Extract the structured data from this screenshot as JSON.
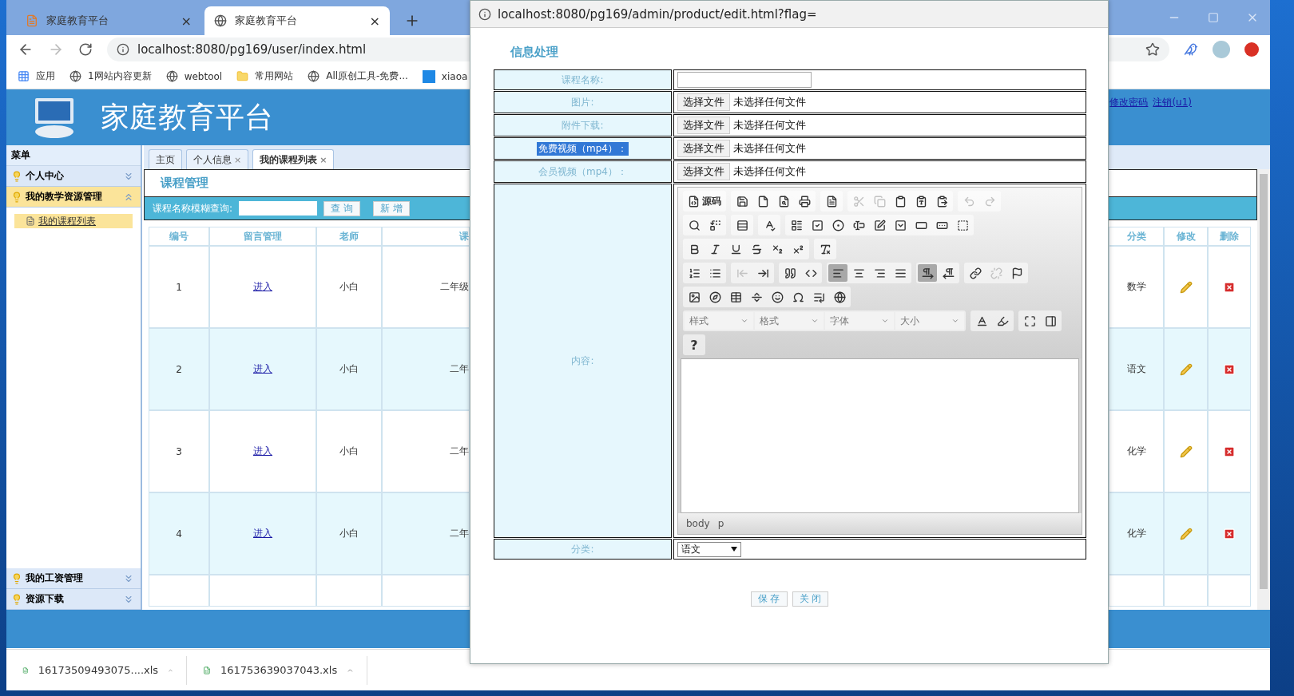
{
  "browser": {
    "tabs": [
      {
        "title": "家庭教育平台",
        "selected": false,
        "close": "×"
      },
      {
        "title": "家庭教育平台",
        "selected": true,
        "close": "×"
      }
    ],
    "url": "localhost:8080/pg169/user/index.html",
    "bookmarks": [
      {
        "label": "应用",
        "kind": "apps"
      },
      {
        "label": "1网站内容更新",
        "kind": "globe"
      },
      {
        "label": "webtool",
        "kind": "globe"
      },
      {
        "label": "常用网站",
        "kind": "folder"
      },
      {
        "label": "All原创工具-免费...",
        "kind": "globe"
      },
      {
        "label": "xiaoa",
        "kind": "p"
      }
    ]
  },
  "header": {
    "title": "家庭教育平台",
    "links": [
      "修改密码",
      "注销(u1)"
    ]
  },
  "sidebar": {
    "title": "菜单",
    "items": [
      {
        "label": "个人中心",
        "expanded": false
      },
      {
        "label": "我的教学资源管理",
        "expanded": true,
        "children": [
          {
            "label": "我的课程列表",
            "selected": true
          }
        ]
      },
      {
        "label": "我的工资管理",
        "expanded": false
      },
      {
        "label": "资源下载",
        "expanded": false
      }
    ]
  },
  "content_tabs": [
    {
      "label": "主页",
      "selected": false
    },
    {
      "label": "个人信息",
      "close": "×",
      "selected": false
    },
    {
      "label": "我的课程列表",
      "close": "×",
      "selected": true
    }
  ],
  "panel": {
    "title": "课程管理",
    "search_label": "课程名称模糊查询:",
    "buttons": [
      "查 询",
      "新 增"
    ]
  },
  "table": {
    "columns": [
      "编号",
      "留言管理",
      "老师",
      "课",
      "分类",
      "修改",
      "删除"
    ],
    "rows": [
      {
        "id": "1",
        "link": "进入",
        "teacher": "小白",
        "column_4": "二年级",
        "category": "数学"
      },
      {
        "id": "2",
        "link": "进入",
        "teacher": "小白",
        "column_4": "二年",
        "category": "语文"
      },
      {
        "id": "3",
        "link": "进入",
        "teacher": "小白",
        "column_4": "二年",
        "category": "化学"
      },
      {
        "id": "4",
        "link": "进入",
        "teacher": "小白",
        "column_4": "二年",
        "category": "化学"
      }
    ]
  },
  "dialog": {
    "url": "localhost:8080/pg169/admin/product/edit.html?flag=",
    "title": "信息处理",
    "fields": [
      {
        "label": "课程名称:",
        "kind": "text",
        "highlighted": false
      },
      {
        "label": "图片:",
        "kind": "file",
        "button": "选择文件",
        "status": "未选择任何文件",
        "highlighted": false
      },
      {
        "label": "附件下载:",
        "kind": "file",
        "button": "选择文件",
        "status": "未选择任何文件",
        "highlighted": false
      },
      {
        "label": "免费视频（mp4）：",
        "kind": "file",
        "button": "选择文件",
        "status": "未选择任何文件",
        "highlighted": true
      },
      {
        "label": "会员视频（mp4）：",
        "kind": "file",
        "button": "选择文件",
        "status": "未选择任何文件",
        "highlighted": false
      },
      {
        "label": "内容:",
        "kind": "editor",
        "highlighted": false
      },
      {
        "label": "分类:",
        "kind": "select",
        "value": "语文",
        "highlighted": false
      }
    ],
    "editor": {
      "toolbar": [
        [
          [
            {
              "kind": "icon_label",
              "label": "源码",
              "disabled": false
            }
          ],
          [
            {
              "kind": "icon",
              "disabled": false
            },
            {
              "kind": "icon",
              "disabled": false
            },
            {
              "kind": "icon",
              "disabled": false
            },
            {
              "kind": "icon",
              "disabled": false
            }
          ],
          [
            {
              "kind": "icon",
              "disabled": false
            }
          ],
          [
            {
              "kind": "icon",
              "disabled": true
            },
            {
              "kind": "icon",
              "disabled": true
            },
            {
              "kind": "icon",
              "disabled": false
            },
            {
              "kind": "icon",
              "disabled": false
            },
            {
              "kind": "icon",
              "disabled": false
            }
          ],
          [
            {
              "kind": "icon",
              "disabled": true
            },
            {
              "kind": "icon",
              "disabled": true
            }
          ]
        ],
        [
          [
            {
              "kind": "icon",
              "disabled": false
            },
            {
              "kind": "icon",
              "disabled": false
            }
          ],
          [
            {
              "kind": "icon",
              "disabled": false
            }
          ],
          [
            {
              "kind": "icon",
              "disabled": false
            }
          ],
          [
            {
              "kind": "icon",
              "disabled": false
            },
            {
              "kind": "icon",
              "disabled": false
            },
            {
              "kind": "icon",
              "disabled": false
            },
            {
              "kind": "icon",
              "disabled": false
            },
            {
              "kind": "icon",
              "disabled": false
            },
            {
              "kind": "icon",
              "disabled": false
            },
            {
              "kind": "icon",
              "disabled": false
            },
            {
              "kind": "icon",
              "disabled": false
            },
            {
              "kind": "icon",
              "disabled": false
            }
          ]
        ],
        [
          [
            {
              "kind": "icon",
              "disabled": false
            },
            {
              "kind": "icon",
              "disabled": false
            },
            {
              "kind": "icon",
              "disabled": false
            },
            {
              "kind": "icon",
              "disabled": false
            },
            {
              "kind": "icon",
              "disabled": false
            },
            {
              "kind": "icon",
              "disabled": false
            }
          ],
          [
            {
              "kind": "icon",
              "disabled": false
            }
          ]
        ],
        [
          [
            {
              "kind": "icon",
              "disabled": false
            },
            {
              "kind": "icon",
              "disabled": false
            }
          ],
          [
            {
              "kind": "icon",
              "disabled": true
            },
            {
              "kind": "icon",
              "disabled": false
            }
          ],
          [
            {
              "kind": "icon",
              "disabled": false
            },
            {
              "kind": "icon",
              "disabled": false
            }
          ],
          [
            {
              "kind": "icon",
              "disabled": false,
              "pressed": true
            },
            {
              "kind": "icon",
              "disabled": false,
              "pressed": false
            },
            {
              "kind": "icon",
              "disabled": false,
              "pressed": false
            },
            {
              "kind": "icon",
              "disabled": false,
              "pressed": false
            }
          ],
          [
            {
              "kind": "icon",
              "disabled": false,
              "pressed": true
            },
            {
              "kind": "icon",
              "disabled": false,
              "pressed": false
            }
          ],
          [
            {
              "kind": "icon",
              "disabled": false
            },
            {
              "kind": "icon",
              "disabled": true
            },
            {
              "kind": "icon",
              "disabled": false
            }
          ]
        ],
        [
          [
            {
              "kind": "icon",
              "disabled": false
            },
            {
              "kind": "icon",
              "disabled": false
            },
            {
              "kind": "icon",
              "disabled": false
            },
            {
              "kind": "icon",
              "disabled": false
            },
            {
              "kind": "icon",
              "disabled": false
            },
            {
              "kind": "icon",
              "disabled": false
            },
            {
              "kind": "icon",
              "disabled": false
            },
            {
              "kind": "icon",
              "disabled": false
            }
          ]
        ],
        [
          [
            {
              "kind": "dropdown",
              "label": "样式",
              "disabled": false
            },
            {
              "kind": "dropdown",
              "label": "格式",
              "disabled": false
            },
            {
              "kind": "dropdown",
              "label": "字体",
              "disabled": false
            },
            {
              "kind": "dropdown",
              "label": "大小",
              "disabled": false
            }
          ],
          [
            {
              "kind": "icon",
              "disabled": false
            },
            {
              "kind": "icon",
              "disabled": false
            }
          ],
          [
            {
              "kind": "icon",
              "disabled": false
            },
            {
              "kind": "icon",
              "disabled": false
            }
          ]
        ],
        [
          [
            {
              "kind": "text",
              "label": "?",
              "disabled": false
            }
          ]
        ]
      ],
      "path": [
        "body",
        "p"
      ]
    },
    "buttons": [
      "保 存",
      "关 闭"
    ]
  },
  "downloads": [
    "16173509493075....xls",
    "161753639037043.xls"
  ]
}
